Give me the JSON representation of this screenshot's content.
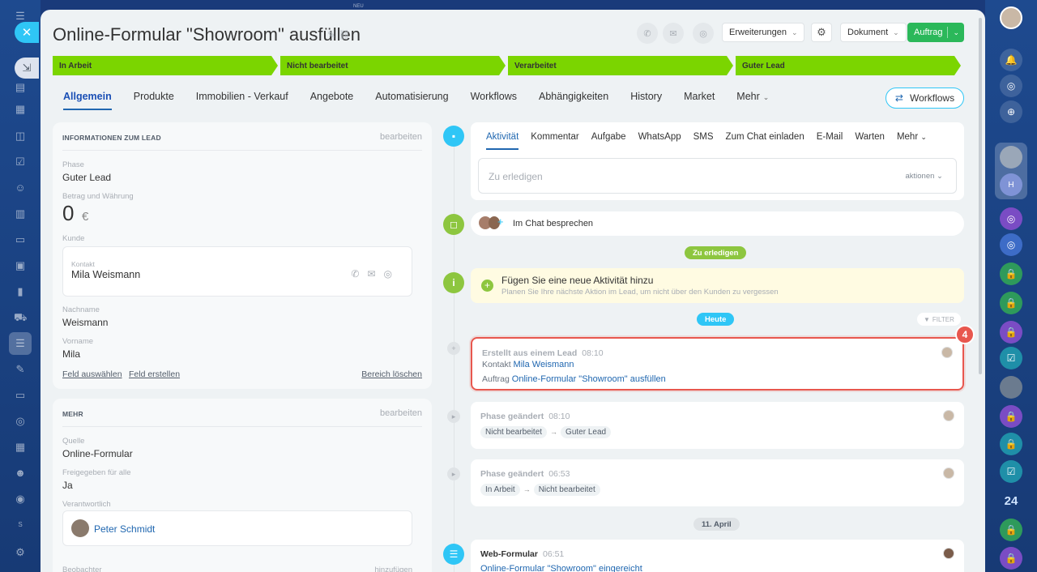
{
  "top_label": "NEU",
  "title": "Online-Formular \"Showroom\" ausfüllen",
  "header": {
    "erweiterungen": "Erweiterungen",
    "dokument": "Dokument",
    "auftrag": "Auftrag"
  },
  "stages": [
    "In Arbeit",
    "Nicht bearbeitet",
    "Verarbeitet",
    "Guter Lead"
  ],
  "tabs": [
    "Allgemein",
    "Produkte",
    "Immobilien - Verkauf",
    "Angebote",
    "Automatisierung",
    "Workflows",
    "Abhängigkeiten",
    "History",
    "Market",
    "Mehr"
  ],
  "workflows_button": "Workflows",
  "info_card": {
    "header": "INFORMATIONEN ZUM LEAD",
    "edit": "bearbeiten",
    "phase_label": "Phase",
    "phase_value": "Guter Lead",
    "amount_label": "Betrag und Währung",
    "amount_value": "0",
    "currency": "€",
    "customer_label": "Kunde",
    "contact_label": "Kontakt",
    "contact_name": "Mila Weismann",
    "lastname_label": "Nachname",
    "lastname_value": "Weismann",
    "firstname_label": "Vorname",
    "firstname_value": "Mila",
    "select_field": "Feld auswählen",
    "create_field": "Feld erstellen",
    "delete_section": "Bereich löschen"
  },
  "more_card": {
    "header": "MEHR",
    "edit": "bearbeiten",
    "source_label": "Quelle",
    "source_value": "Online-Formular",
    "shared_label": "Freigegeben für alle",
    "shared_value": "Ja",
    "responsible_label": "Verantwortlich",
    "responsible_name": "Peter Schmidt",
    "observer_label": "Beobachter",
    "add": "hinzufügen"
  },
  "activity": {
    "tabs": [
      "Aktivität",
      "Kommentar",
      "Aufgabe",
      "WhatsApp",
      "SMS",
      "Zum Chat einladen",
      "E-Mail",
      "Warten",
      "Mehr"
    ],
    "placeholder": "Zu erledigen",
    "actions": "aktionen"
  },
  "chat_discuss": "Im Chat besprechen",
  "todo_pill": "Zu erledigen",
  "new_activity": {
    "title": "Fügen Sie eine neue Aktivität hinzu",
    "subtitle": "Planen Sie Ihre nächste Aktion im Lead, um nicht über den Kunden zu vergessen"
  },
  "today_pill": "Heute",
  "filter": "FILTER",
  "badge": "4",
  "events": [
    {
      "title": "Erstellt aus einem Lead",
      "time": "08:10",
      "kontakt_label": "Kontakt",
      "kontakt_value": "Mila Weismann",
      "auftrag_label": "Auftrag",
      "auftrag_value": "Online-Formular \"Showroom\" ausfüllen"
    },
    {
      "title": "Phase geändert",
      "time": "08:10",
      "from": "Nicht bearbeitet",
      "to": "Guter Lead"
    },
    {
      "title": "Phase geändert",
      "time": "06:53",
      "from": "In Arbeit",
      "to": "Nicht bearbeitet"
    }
  ],
  "date_pill": "11. April",
  "web_form": {
    "title": "Web-Formular",
    "time": "06:51",
    "text": "Online-Formular \"Showroom\" eingereicht"
  },
  "right_rail_number": "24",
  "left_rail_badge": "S",
  "colors": {
    "stage_green": "#7bd500",
    "accent_blue": "#2fc6f6",
    "link_blue": "#2067b0",
    "highlight_red": "#e8574e"
  }
}
